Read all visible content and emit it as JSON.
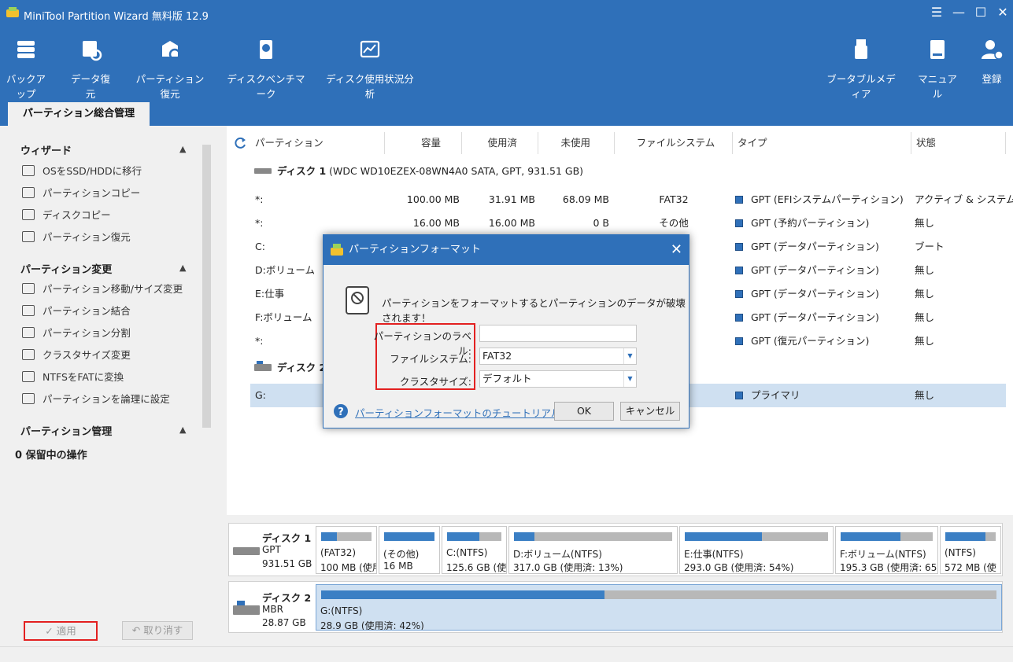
{
  "window": {
    "title": "MiniTool Partition Wizard 無料版 12.9",
    "controls": [
      "☰",
      "—",
      "☐",
      "✕"
    ]
  },
  "toolbar": {
    "left": [
      {
        "label": "バックアップ",
        "icon": "backup-icon"
      },
      {
        "label": "データ復元",
        "icon": "data-recovery-icon"
      },
      {
        "label": "パーティション復元",
        "icon": "partition-recovery-icon"
      },
      {
        "label": "ディスクベンチマーク",
        "icon": "disk-benchmark-icon"
      },
      {
        "label": "ディスク使用状況分析",
        "icon": "space-analyzer-icon"
      }
    ],
    "right": [
      {
        "label": "ブータブルメディア",
        "icon": "bootable-media-icon"
      },
      {
        "label": "マニュアル",
        "icon": "manual-icon"
      },
      {
        "label": "登録",
        "icon": "register-icon"
      }
    ]
  },
  "tab": {
    "label": "パーティション総合管理"
  },
  "sidebar": {
    "sections": [
      {
        "title": "ウィザード",
        "items": [
          "OSをSSD/HDDに移行",
          "パーティションコピー",
          "ディスクコピー",
          "パーティション復元"
        ]
      },
      {
        "title": "パーティション変更",
        "items": [
          "パーティション移動/サイズ変更",
          "パーティション結合",
          "パーティション分割",
          "クラスタサイズ変更",
          "NTFSをFATに変換",
          "パーティションを論理に設定"
        ]
      },
      {
        "title": "パーティション管理",
        "items": []
      }
    ],
    "pending": "0 保留中の操作",
    "apply_label": "✓ 適用",
    "undo_label": "↶ 取り消す"
  },
  "table": {
    "columns": [
      "パーティション",
      "容量",
      "使用済",
      "未使用",
      "ファイルシステム",
      "タイプ",
      "状態"
    ],
    "disk1_label": "ディスク 1",
    "disk1_desc": "(WDC WD10EZEX-08WN4A0 SATA, GPT, 931.51 GB)",
    "disk2_label": "ディスク 2",
    "rows": [
      {
        "name": "*:",
        "cap": "100.00 MB",
        "used": "31.91 MB",
        "free": "68.09 MB",
        "fs": "FAT32",
        "type": "GPT (EFIシステムパーティション)",
        "status": "アクティブ & システム"
      },
      {
        "name": "*:",
        "cap": "16.00 MB",
        "used": "16.00 MB",
        "free": "0 B",
        "fs": "その他",
        "type": "GPT (予約パーティション)",
        "status": "無し"
      },
      {
        "name": "C:",
        "cap": "",
        "used": "",
        "free": "",
        "fs": "",
        "type": "GPT (データパーティション)",
        "status": "ブート"
      },
      {
        "name": "D:ボリューム",
        "cap": "",
        "used": "",
        "free": "",
        "fs": "",
        "type": "GPT (データパーティション)",
        "status": "無し"
      },
      {
        "name": "E:仕事",
        "cap": "",
        "used": "",
        "free": "",
        "fs": "",
        "type": "GPT (データパーティション)",
        "status": "無し"
      },
      {
        "name": "F:ボリューム",
        "cap": "",
        "used": "",
        "free": "",
        "fs": "",
        "type": "GPT (データパーティション)",
        "status": "無し"
      },
      {
        "name": "*:",
        "cap": "",
        "used": "",
        "free": "",
        "fs": "",
        "type": "GPT (復元パーティション)",
        "status": "無し"
      }
    ],
    "disk2_row": {
      "name": "G:",
      "type": "プライマリ",
      "status": "無し"
    }
  },
  "diskmap": {
    "disk1": {
      "name": "ディスク 1",
      "scheme": "GPT",
      "size": "931.51 GB"
    },
    "disk1_parts": [
      {
        "l1": "(FAT32)",
        "l2": "100 MB (使用",
        "used": 0.32
      },
      {
        "l1": "(その他)",
        "l2": "16 MB",
        "used": 1.0
      },
      {
        "l1": "C:(NTFS)",
        "l2": "125.6 GB (使",
        "used": 0.6
      },
      {
        "l1": "D:ボリューム(NTFS)",
        "l2": "317.0 GB (使用済: 13%)",
        "used": 0.13
      },
      {
        "l1": "E:仕事(NTFS)",
        "l2": "293.0 GB (使用済: 54%)",
        "used": 0.54
      },
      {
        "l1": "F:ボリューム(NTFS)",
        "l2": "195.3 GB (使用済: 65%",
        "used": 0.65
      },
      {
        "l1": "(NTFS)",
        "l2": "572 MB (使",
        "used": 0.8
      }
    ],
    "disk2": {
      "name": "ディスク 2",
      "scheme": "MBR",
      "size": "28.87 GB"
    },
    "disk2_part": {
      "l1": "G:(NTFS)",
      "l2": "28.9 GB (使用済: 42%)",
      "used": 0.42
    }
  },
  "dialog": {
    "title": "パーティションフォーマット",
    "close": "✕",
    "message": "パーティションをフォーマットするとパーティションのデータが破壊されます！",
    "label_field": "パーティションのラベル:",
    "label_value": "",
    "fs_field": "ファイルシステム:",
    "fs_value": "FAT32",
    "cluster_field": "クラスタサイズ:",
    "cluster_value": "デフォルト",
    "tutorial_link": "パーティションフォーマットのチュートリアル",
    "ok_label": "OK",
    "cancel_label": "キャンセル"
  }
}
